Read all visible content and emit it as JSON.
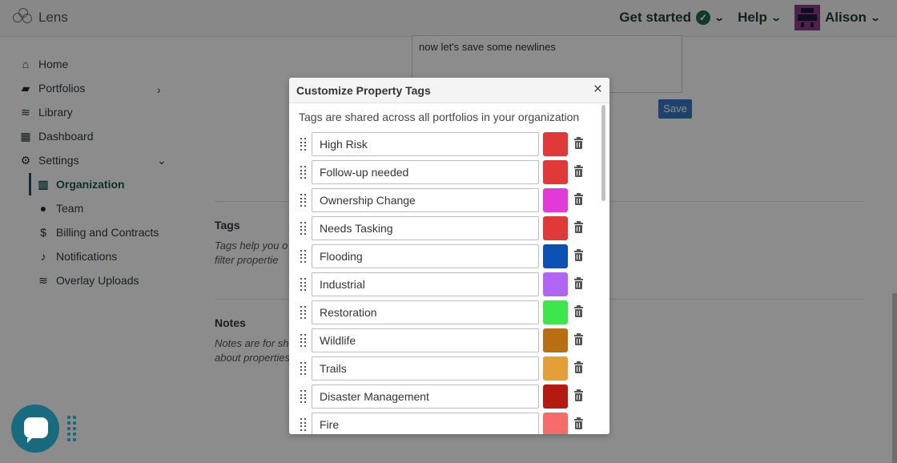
{
  "app": {
    "name": "Lens"
  },
  "nav": {
    "get_started": "Get started",
    "help": "Help",
    "user": "Alison"
  },
  "sidebar": {
    "items": [
      {
        "label": "Home",
        "icon": "home-icon"
      },
      {
        "label": "Portfolios",
        "icon": "folder-icon"
      },
      {
        "label": "Library",
        "icon": "layers-icon"
      },
      {
        "label": "Dashboard",
        "icon": "dashboard-icon"
      },
      {
        "label": "Settings",
        "icon": "gear-icon"
      },
      {
        "label": "Organization",
        "icon": "building-icon"
      },
      {
        "label": "Team",
        "icon": "user-icon"
      },
      {
        "label": "Billing and Contracts",
        "icon": "dollar-icon"
      },
      {
        "label": "Notifications",
        "icon": "bell-icon"
      },
      {
        "label": "Overlay Uploads",
        "icon": "layers-icon"
      }
    ]
  },
  "main": {
    "notes_text": "now let's save some newlines",
    "save_label": "Save",
    "tags_title": "Tags",
    "tags_desc_1": "Tags help you o",
    "tags_desc_2": "filter propertie",
    "notes_title": "Notes",
    "notes_desc_1": "Notes are for sh",
    "notes_desc_2": "about properties"
  },
  "modal": {
    "title": "Customize Property Tags",
    "close": "×",
    "description": "Tags are shared across all portfolios in your organization",
    "tags": [
      {
        "name": "High Risk",
        "color": "#e0393a"
      },
      {
        "name": "Follow-up needed",
        "color": "#e0393a"
      },
      {
        "name": "Ownership Change",
        "color": "#e23ad9"
      },
      {
        "name": "Needs Tasking",
        "color": "#e0393a"
      },
      {
        "name": "Flooding",
        "color": "#0b52b4"
      },
      {
        "name": "Industrial",
        "color": "#b066f2"
      },
      {
        "name": "Restoration",
        "color": "#3ee64b"
      },
      {
        "name": "Wildlife",
        "color": "#b86e12"
      },
      {
        "name": "Trails",
        "color": "#e3a03a"
      },
      {
        "name": "Disaster Management",
        "color": "#b51a10"
      },
      {
        "name": "Fire",
        "color": "#f56d6a"
      }
    ]
  }
}
